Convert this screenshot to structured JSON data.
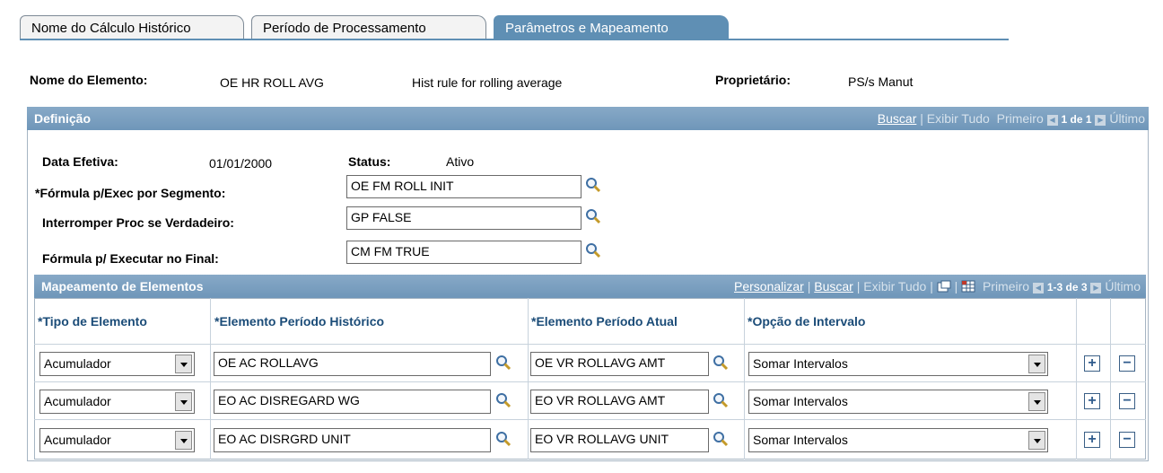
{
  "tabs": [
    {
      "label": "Nome do Cálculo Histórico",
      "active": false
    },
    {
      "label": "Período de Processamento",
      "active": false
    },
    {
      "label": "Parâmetros e Mapeamento",
      "active": true
    }
  ],
  "header": {
    "element_label": "Nome do Elemento:",
    "element_name": "OE HR ROLL AVG",
    "element_desc": "Hist rule for rolling average",
    "owner_label": "Proprietário:",
    "owner_value": "PS/s Manut"
  },
  "definition": {
    "title": "Definição",
    "nav": {
      "find": "Buscar",
      "view_all": "Exibir Tudo",
      "first": "Primeiro",
      "count": "1 de 1",
      "last": "Último"
    },
    "effdt_label": "Data Efetiva:",
    "effdt_value": "01/01/2000",
    "status_label": "Status:",
    "status_value": "Ativo",
    "fields": [
      {
        "label": "*Fórmula p/Exec por Segmento:",
        "value": "OE FM ROLL INIT"
      },
      {
        "label": "Interromper Proc se Verdadeiro:",
        "value": "GP FALSE"
      },
      {
        "label": "Fórmula p/ Executar no Final:",
        "value": "CM FM TRUE"
      }
    ]
  },
  "mapping": {
    "title": "Mapeamento de Elementos",
    "nav": {
      "personalize": "Personalizar",
      "find": "Buscar",
      "view_all": "Exibir Tudo",
      "first": "Primeiro",
      "count": "1-3 de 3",
      "last": "Último"
    },
    "columns": [
      "*Tipo de Elemento",
      "*Elemento Período Histórico",
      "*Elemento Período Atual",
      "*Opção de Intervalo"
    ],
    "rows": [
      {
        "type": "Acumulador",
        "hist": "OE AC ROLLAVG",
        "current": "OE VR ROLLAVG AMT",
        "option": "Somar Intervalos"
      },
      {
        "type": "Acumulador",
        "hist": "EO AC DISREGARD WG",
        "current": "EO VR ROLLAVG AMT",
        "option": "Somar Intervalos"
      },
      {
        "type": "Acumulador",
        "hist": "EO AC DISRGRD UNIT",
        "current": "EO VR ROLLAVG UNIT",
        "option": "Somar Intervalos"
      }
    ],
    "add_symbol": "+",
    "delete_symbol": "−"
  }
}
